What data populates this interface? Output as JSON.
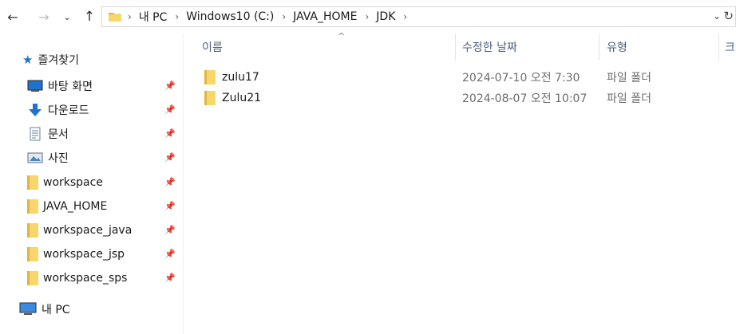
{
  "nav": {
    "back_glyph": "←",
    "forward_glyph": "→",
    "recent_glyph": "⌄",
    "up_glyph": "↑"
  },
  "address": {
    "crumbs": [
      "내 PC",
      "Windows10 (C:)",
      "JAVA_HOME",
      "JDK"
    ],
    "dropdown_glyph": "⌄",
    "refresh_glyph": "↻"
  },
  "sidebar": {
    "quick_access_label": "즐겨찾기",
    "items": [
      {
        "label": "바탕 화면",
        "icon": "desktop-icon"
      },
      {
        "label": "다운로드",
        "icon": "download-icon"
      },
      {
        "label": "문서",
        "icon": "document-icon"
      },
      {
        "label": "사진",
        "icon": "pictures-icon"
      },
      {
        "label": "workspace",
        "icon": "folder-icon"
      },
      {
        "label": "JAVA_HOME",
        "icon": "folder-icon"
      },
      {
        "label": "workspace_java",
        "icon": "folder-icon"
      },
      {
        "label": "workspace_jsp",
        "icon": "folder-icon"
      },
      {
        "label": "workspace_sps",
        "icon": "folder-icon"
      }
    ],
    "pin_glyph": "📌",
    "this_pc_label": "내 PC"
  },
  "columns": {
    "name": "이름",
    "date": "수정한 날짜",
    "type": "유형",
    "size_partial": "크"
  },
  "files": [
    {
      "name": "zulu17",
      "date": "2024-07-10 오전 7:30",
      "type": "파일 폴더"
    },
    {
      "name": "Zulu21",
      "date": "2024-08-07 오전 10:07",
      "type": "파일 폴더"
    }
  ],
  "colors": {
    "folder_yellow": "#f7d66b",
    "folder_dark": "#e4b43c",
    "accent_blue": "#1e73d2"
  }
}
